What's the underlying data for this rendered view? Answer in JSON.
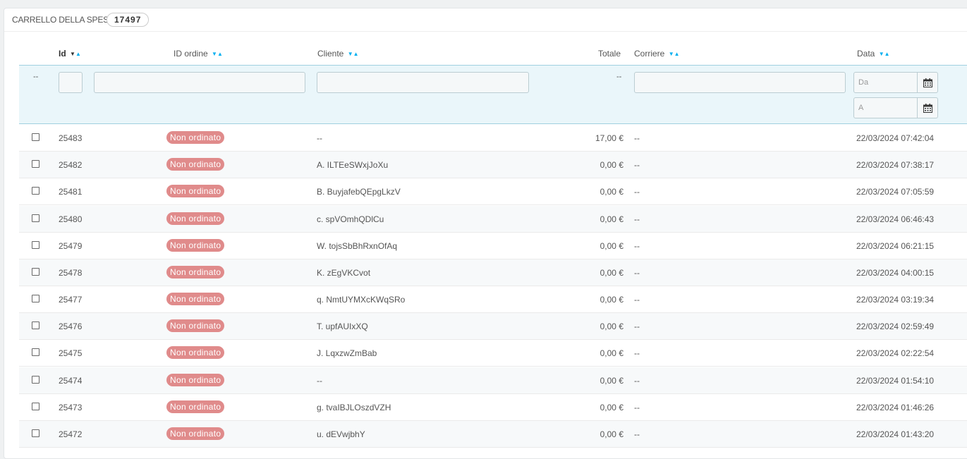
{
  "panel": {
    "title": "CARRELLO DELLA SPESA",
    "count": "17497"
  },
  "columns": {
    "id": "Id",
    "order_id": "ID ordine",
    "customer": "Cliente",
    "total": "Totale",
    "carrier": "Corriere",
    "date": "Data"
  },
  "filters": {
    "checkbox_col": "--",
    "total_col": "--",
    "date_from_placeholder": "Da",
    "date_to_placeholder": "A"
  },
  "rows": [
    {
      "id": "25483",
      "status": "Non ordinato",
      "customer": "--",
      "total": "17,00 €",
      "carrier": "--",
      "date": "22/03/2024 07:42:04"
    },
    {
      "id": "25482",
      "status": "Non ordinato",
      "customer": "A. ILTEeSWxjJoXu",
      "total": "0,00 €",
      "carrier": "--",
      "date": "22/03/2024 07:38:17"
    },
    {
      "id": "25481",
      "status": "Non ordinato",
      "customer": "B. BuyjafebQEpgLkzV",
      "total": "0,00 €",
      "carrier": "--",
      "date": "22/03/2024 07:05:59"
    },
    {
      "id": "25480",
      "status": "Non ordinato",
      "customer": "c. spVOmhQDlCu",
      "total": "0,00 €",
      "carrier": "--",
      "date": "22/03/2024 06:46:43"
    },
    {
      "id": "25479",
      "status": "Non ordinato",
      "customer": "W. tojsSbBhRxnOfAq",
      "total": "0,00 €",
      "carrier": "--",
      "date": "22/03/2024 06:21:15"
    },
    {
      "id": "25478",
      "status": "Non ordinato",
      "customer": "K. zEgVKCvot",
      "total": "0,00 €",
      "carrier": "--",
      "date": "22/03/2024 04:00:15"
    },
    {
      "id": "25477",
      "status": "Non ordinato",
      "customer": "q. NmtUYMXcKWqSRo",
      "total": "0,00 €",
      "carrier": "--",
      "date": "22/03/2024 03:19:34"
    },
    {
      "id": "25476",
      "status": "Non ordinato",
      "customer": "T. upfAUIxXQ",
      "total": "0,00 €",
      "carrier": "--",
      "date": "22/03/2024 02:59:49"
    },
    {
      "id": "25475",
      "status": "Non ordinato",
      "customer": "J. LqxzwZmBab",
      "total": "0,00 €",
      "carrier": "--",
      "date": "22/03/2024 02:22:54"
    },
    {
      "id": "25474",
      "status": "Non ordinato",
      "customer": "--",
      "total": "0,00 €",
      "carrier": "--",
      "date": "22/03/2024 01:54:10"
    },
    {
      "id": "25473",
      "status": "Non ordinato",
      "customer": "g. tvaIBJLOszdVZH",
      "total": "0,00 €",
      "carrier": "--",
      "date": "22/03/2024 01:46:26"
    },
    {
      "id": "25472",
      "status": "Non ordinato",
      "customer": "u. dEVwjbhY",
      "total": "0,00 €",
      "carrier": "--",
      "date": "22/03/2024 01:43:20"
    }
  ],
  "colors": {
    "status_badge": "#e08b8b",
    "sort_arrow": "#00aff0",
    "filter_bg": "#eaf6fa"
  }
}
